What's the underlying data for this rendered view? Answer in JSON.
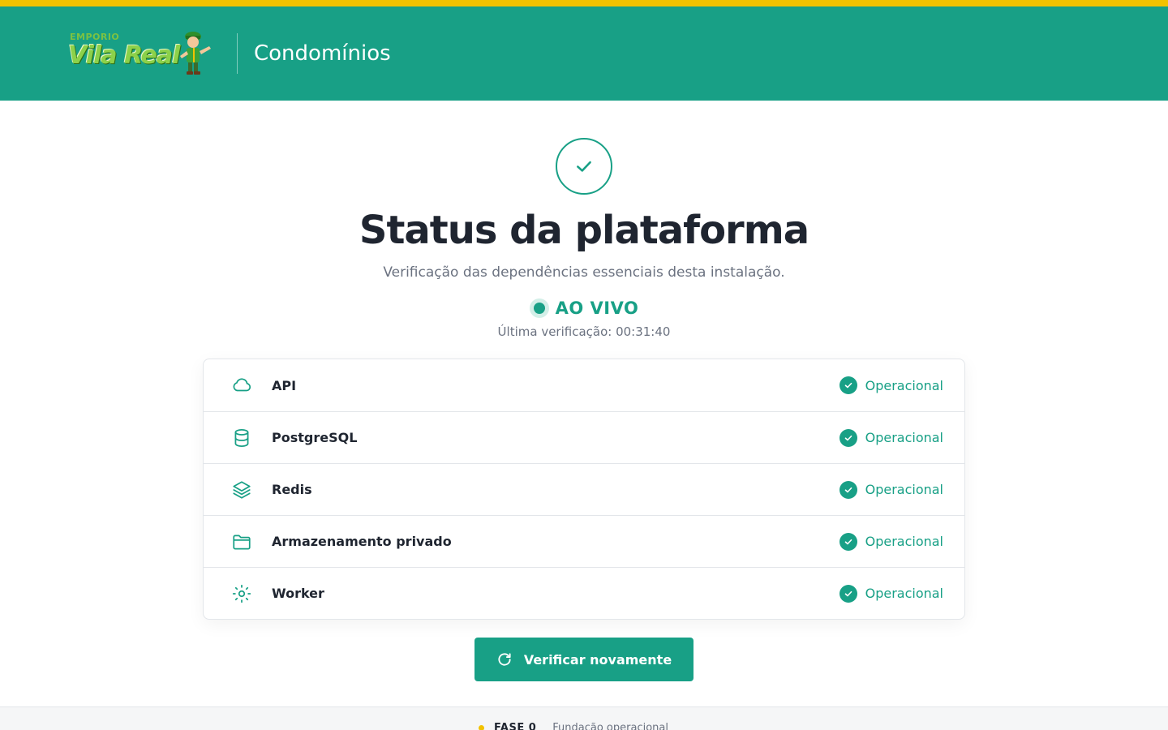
{
  "header": {
    "logo_small": "EMPORIO",
    "logo_main": "Vila Real",
    "title": "Condomínios"
  },
  "main": {
    "title": "Status da plataforma",
    "subtitle": "Verificação das dependências essenciais desta instalação.",
    "live_label": "AO VIVO",
    "last_check": "Última verificação: 00:31:40"
  },
  "services": [
    {
      "name": "API",
      "icon": "cloud-icon",
      "status": "Operacional"
    },
    {
      "name": "PostgreSQL",
      "icon": "database-icon",
      "status": "Operacional"
    },
    {
      "name": "Redis",
      "icon": "layers-icon",
      "status": "Operacional"
    },
    {
      "name": "Armazenamento privado",
      "icon": "folder-icon",
      "status": "Operacional"
    },
    {
      "name": "Worker",
      "icon": "sun-icon",
      "status": "Operacional"
    }
  ],
  "actions": {
    "recheck_label": "Verificar novamente"
  },
  "footer": {
    "phase": "FASE 0",
    "description": "Fundação operacional"
  },
  "colors": {
    "brand": "#18a086",
    "accent": "#f2c200",
    "text": "#1f2530",
    "muted": "#6b7280"
  }
}
